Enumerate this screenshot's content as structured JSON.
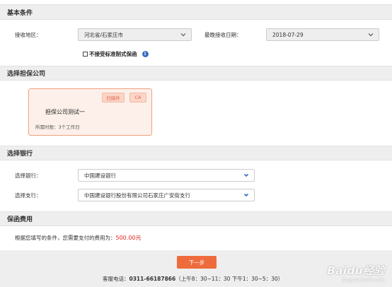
{
  "basic": {
    "title": "基本条件",
    "region_label": "接收地区：",
    "region_value": "河北省/石家庄市",
    "date_label": "最晚接收日期：",
    "date_value": "2018-07-29",
    "checkbox_label": "不接受标准制式保函",
    "info_glyph": "i"
  },
  "guarantor": {
    "title": "选择担保公司",
    "card": {
      "tags": [
        "扫描件",
        "CA"
      ],
      "name": "担保公司测试一",
      "time": "所需时限：3个工作日"
    }
  },
  "bank": {
    "title": "选择银行",
    "bank_label": "选择银行：",
    "bank_value": "中国建设银行",
    "branch_label": "选择支行：",
    "branch_value": "中国建设银行股份有限公司石家庄广安街支行"
  },
  "fee": {
    "title": "保函费用",
    "text": "根据您填写的条件，您需要支付的费用为：",
    "amount": "500.00元"
  },
  "footer": {
    "next_label": "下一步",
    "hotline_label": "客服电话：",
    "hotline_number": "0311-66187866",
    "hotline_hours": "（上午8：30~11：30 下午1：30~5：30）"
  },
  "watermark": {
    "logo": "Baidu经验",
    "url": "jingyan.baidu.com"
  },
  "colors": {
    "accent": "#ee6b3c",
    "price": "#e02020",
    "info": "#3a6fc2",
    "select_chevron_gray": "#555555",
    "select_chevron_blue": "#3a6fc2"
  }
}
